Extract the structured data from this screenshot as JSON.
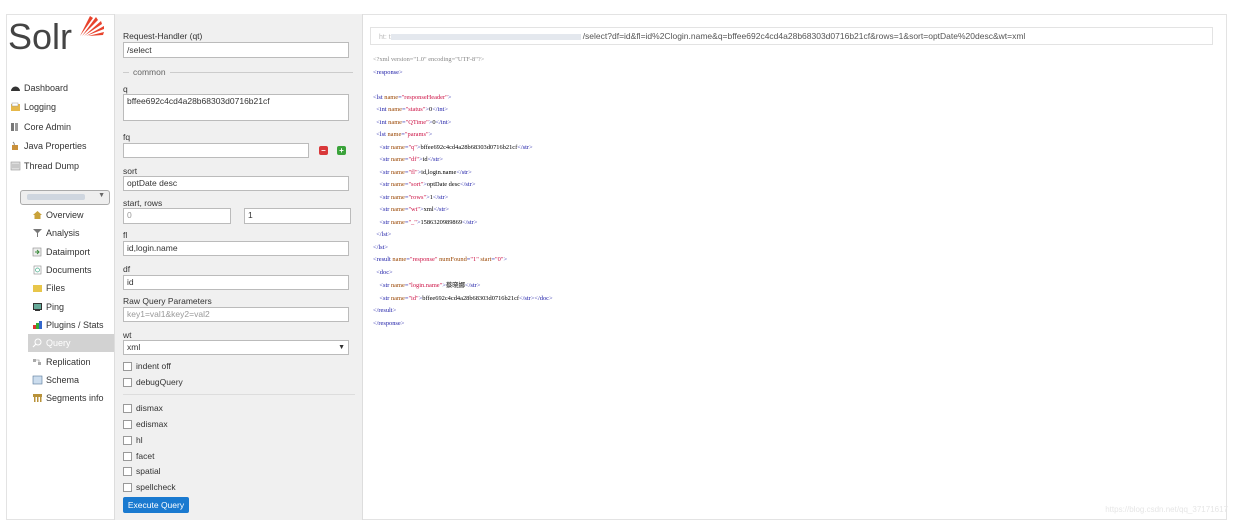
{
  "app": {
    "logo_text": "Solr"
  },
  "sidebar": {
    "items": [
      {
        "label": "Dashboard",
        "icon": "dashboard-icon"
      },
      {
        "label": "Logging",
        "icon": "logging-icon"
      },
      {
        "label": "Core Admin",
        "icon": "core-admin-icon"
      },
      {
        "label": "Java Properties",
        "icon": "java-properties-icon"
      },
      {
        "label": "Thread Dump",
        "icon": "thread-dump-icon"
      }
    ],
    "core_items": [
      {
        "label": "Overview",
        "icon": "overview-icon"
      },
      {
        "label": "Analysis",
        "icon": "analysis-icon"
      },
      {
        "label": "Dataimport",
        "icon": "dataimport-icon"
      },
      {
        "label": "Documents",
        "icon": "documents-icon"
      },
      {
        "label": "Files",
        "icon": "files-icon"
      },
      {
        "label": "Ping",
        "icon": "ping-icon"
      },
      {
        "label": "Plugins / Stats",
        "icon": "plugins-icon"
      },
      {
        "label": "Query",
        "icon": "query-icon",
        "active": true
      },
      {
        "label": "Replication",
        "icon": "replication-icon"
      },
      {
        "label": "Schema",
        "icon": "schema-icon"
      },
      {
        "label": "Segments info",
        "icon": "segments-icon"
      }
    ]
  },
  "form": {
    "request_handler_label": "Request-Handler (qt)",
    "request_handler_value": "/select",
    "common_legend": "common",
    "q_label": "q",
    "q_value": "bffee692c4cd4a28b68303d0716b21cf",
    "fq_label": "fq",
    "fq_value": "",
    "sort_label": "sort",
    "sort_value": "optDate desc",
    "start_rows_label": "start, rows",
    "start_value": "0",
    "rows_value": "1",
    "fl_label": "fl",
    "fl_value": "id,login.name",
    "df_label": "df",
    "df_value": "id",
    "raw_label": "Raw Query Parameters",
    "raw_placeholder": "key1=val1&key2=val2",
    "wt_label": "wt",
    "wt_value": "xml",
    "indent_label": "indent off",
    "debug_label": "debugQuery",
    "dismax_label": "dismax",
    "edismax_label": "edismax",
    "hl_label": "hl",
    "facet_label": "facet",
    "spatial_label": "spatial",
    "spellcheck_label": "spellcheck",
    "execute_label": "Execute Query",
    "minus_label": "–",
    "plus_label": "+"
  },
  "result": {
    "url_prefix": "ht: t",
    "url_suffix": "/select?df=id&fl=id%2Clogin.name&q=bffee692c4cd4a28b68303d0716b21cf&rows=1&sort=optDate%20desc&wt=xml",
    "status": "0",
    "qtime": "0",
    "q": "bffee692c4cd4a28b68303d0716b21cf",
    "df": "id",
    "fl": "id,login.name",
    "sort": "optDate desc",
    "rows": "1",
    "wt": "xml",
    "underscore": "1586320989869",
    "num_found": "1",
    "start": "0",
    "login_name": "蔡晓娜",
    "doc_id": "bffee692c4cd4a28b68303d0716b21cf"
  },
  "watermark": "https://blog.csdn.net/qq_37171617",
  "colors": {
    "accent": "#1a7ad0",
    "minus": "#d9383a",
    "plus": "#3aa33a",
    "active_nav": "#d2d2d2"
  }
}
